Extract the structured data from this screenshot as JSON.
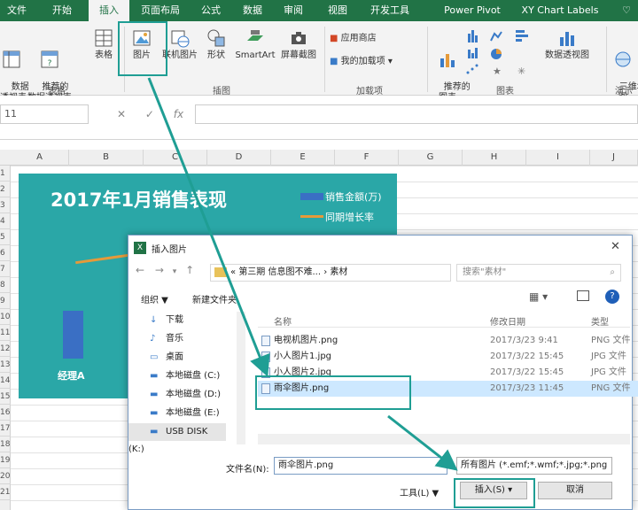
{
  "ribbon": {
    "tabs": [
      "文件",
      "开始",
      "插入",
      "页面布局",
      "公式",
      "数据",
      "审阅",
      "视图",
      "开发工具",
      "Power Pivot",
      "XY Chart Labels"
    ],
    "buttons": {
      "pivot": "数据\n透视表",
      "recommend_pivot": "推荐的\n数据透视表",
      "table": "表格",
      "picture": "图片",
      "online_picture": "联机图片",
      "shapes": "形状",
      "smartart": "SmartArt",
      "screenshot": "屏幕截图",
      "store": "应用商店",
      "my_addins": "我的加载项",
      "recommended_charts": "推荐的\n图表",
      "pivot_chart": "数据透视图",
      "map3d": "三维地\n图"
    },
    "groups": {
      "tables": "表格",
      "illustrations": "插图",
      "addins": "加载项",
      "charts": "图表",
      "tours": "演示"
    }
  },
  "formula_bar": {
    "name_box": "11",
    "cancel": "✕",
    "enter": "✓",
    "fx": "fx",
    "value": ""
  },
  "grid": {
    "columns": [
      "A",
      "B",
      "C",
      "D",
      "E",
      "F",
      "G",
      "H",
      "I",
      "J"
    ],
    "rows": [
      "1",
      "2",
      "3",
      "4",
      "5",
      "6",
      "7",
      "8",
      "9",
      "10",
      "11",
      "12",
      "13",
      "14",
      "15",
      "16",
      "17",
      "18",
      "19",
      "20",
      "21"
    ]
  },
  "chart": {
    "title": "2017年1月销售表现",
    "legend": [
      "销售金额(万)",
      "同期增长率"
    ],
    "category_label": "经理A",
    "colors": {
      "background": "#2aa7a7",
      "bar": "#3a6fc4",
      "line": "#e59a3a"
    }
  },
  "dialog": {
    "title": "插入图片",
    "close": "✕",
    "breadcrumb": [
      "«",
      "第三期 信息图不难...",
      "›",
      "素材"
    ],
    "search_placeholder": "搜索\"素材\"",
    "organize": "组织 ▼",
    "new_folder": "新建文件夹",
    "nav_items": [
      "下载",
      "音乐",
      "桌面",
      "本地磁盘 (C:)",
      "本地磁盘 (D:)",
      "本地磁盘 (E:)",
      "USB DISK (K:)"
    ],
    "columns": {
      "name": "名称",
      "date": "修改日期",
      "type": "类型"
    },
    "files": [
      {
        "name": "电视机图片.png",
        "date": "2017/3/23 9:41",
        "type": "PNG 文件"
      },
      {
        "name": "小人图片1.jpg",
        "date": "2017/3/22 15:45",
        "type": "JPG 文件"
      },
      {
        "name": "小人图片2.jpg",
        "date": "2017/3/22 15:45",
        "type": "JPG 文件"
      },
      {
        "name": "雨伞图片.png",
        "date": "2017/3/23 11:45",
        "type": "PNG 文件"
      }
    ],
    "filename_label": "文件名(N):",
    "filename_value": "雨伞图片.png",
    "filetype_value": "所有图片 (*.emf;*.wmf;*.jpg;*.png",
    "tools": "工具(L) ▼",
    "insert": "插入(S)",
    "cancel": "取消"
  }
}
